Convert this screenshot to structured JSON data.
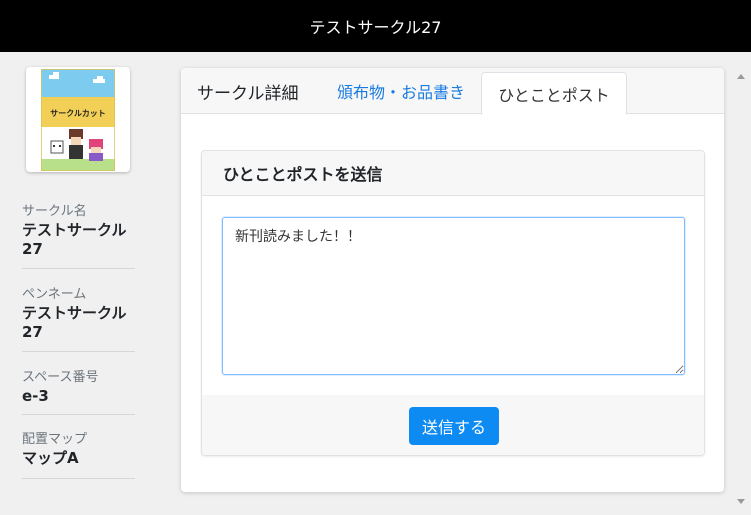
{
  "header": {
    "title": "テストサークル27"
  },
  "sidebar": {
    "thumbnail": {
      "text": "サークルカット"
    },
    "fields": [
      {
        "label": "サークル名",
        "value": "テストサークル27"
      },
      {
        "label": "ペンネーム",
        "value": "テストサークル27"
      },
      {
        "label": "スペース番号",
        "value": "e-3"
      },
      {
        "label": "配置マップ",
        "value": "マップA"
      }
    ]
  },
  "tabs": [
    {
      "label": "サークル詳細",
      "state": "plain"
    },
    {
      "label": "頒布物・お品書き",
      "state": "link"
    },
    {
      "label": "ひとことポスト",
      "state": "active"
    }
  ],
  "post_form": {
    "title": "ひとことポストを送信",
    "message": "新刊読みました！！",
    "submit_label": "送信する"
  },
  "colors": {
    "header_bg": "#000000",
    "accent": "#0d8bf2",
    "link": "#1a7be0"
  }
}
